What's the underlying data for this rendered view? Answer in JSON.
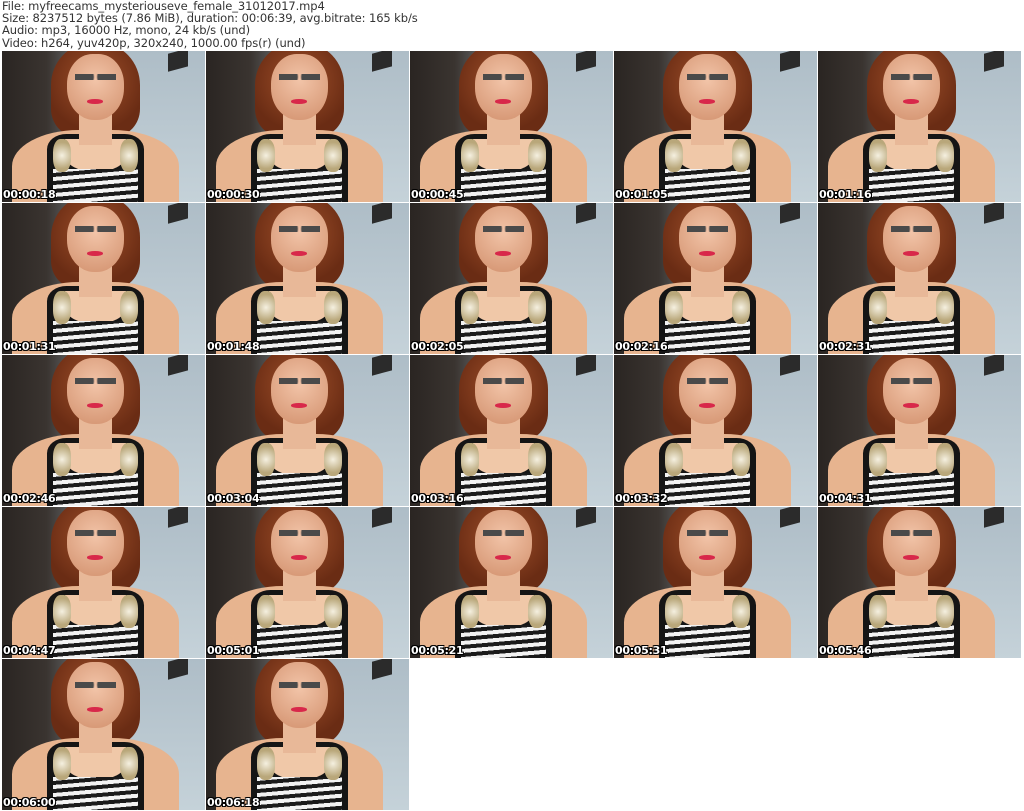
{
  "header": {
    "file": "File: myfreecams_mysteriouseve_female_31012017.mp4",
    "size": "Size: 8237512 bytes (7.86 MiB), duration: 00:06:39, avg.bitrate: 165 kb/s",
    "audio": "Audio: mp3, 16000 Hz, mono, 24 kb/s (und)",
    "video": "Video: h264, yuv420p, 320x240, 1000.00 fps(r) (und)"
  },
  "thumbnails": [
    "00:00:18",
    "00:00:30",
    "00:00:45",
    "00:01:05",
    "00:01:16",
    "00:01:31",
    "00:01:48",
    "00:02:05",
    "00:02:16",
    "00:02:31",
    "00:02:46",
    "00:03:04",
    "00:03:16",
    "00:03:32",
    "00:04:31",
    "00:04:47",
    "00:05:01",
    "00:05:21",
    "00:05:31",
    "00:05:46",
    "00:06:00",
    "00:06:18"
  ]
}
